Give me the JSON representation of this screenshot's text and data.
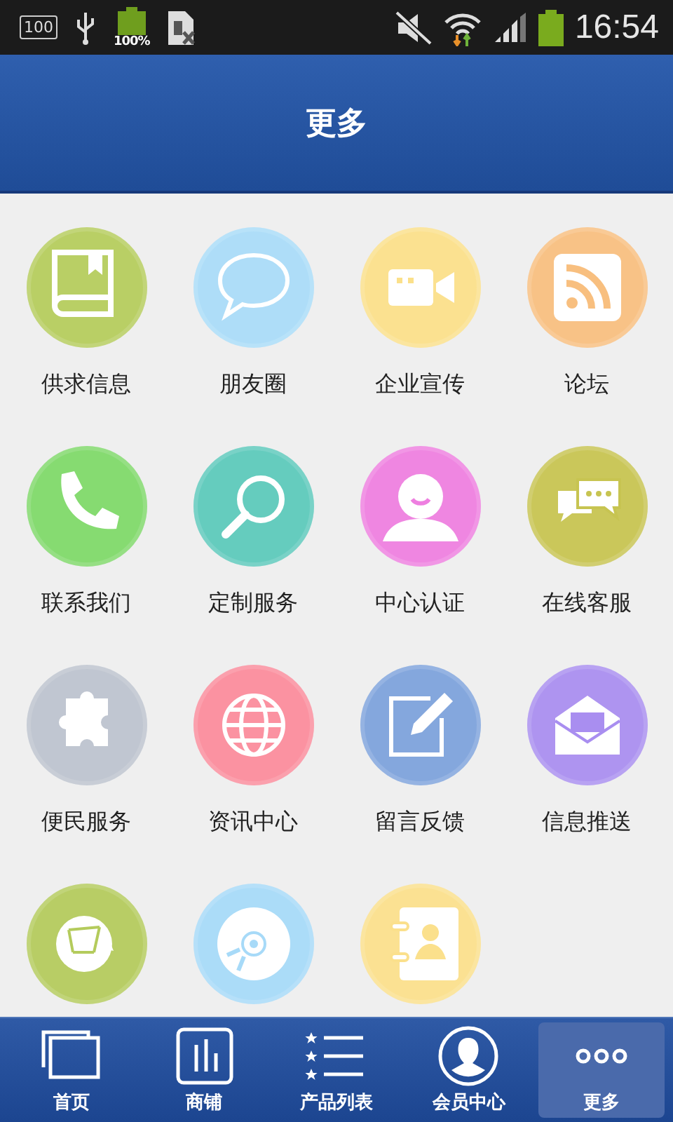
{
  "status_bar": {
    "notification_count": "100",
    "battery_percent": "100%",
    "time": "16:54"
  },
  "header": {
    "title": "更多"
  },
  "items": [
    {
      "label": "供求信息",
      "kind": "book",
      "color": "#b5cc5c"
    },
    {
      "label": "朋友圈",
      "kind": "chat",
      "color": "#a9dcf8"
    },
    {
      "label": "企业宣传",
      "kind": "camera",
      "color": "#fbe08a"
    },
    {
      "label": "论坛",
      "kind": "rss",
      "color": "#f8bf7f"
    },
    {
      "label": "联系我们",
      "kind": "phone",
      "color": "#7fd86a"
    },
    {
      "label": "定制服务",
      "kind": "search",
      "color": "#5cc9bb"
    },
    {
      "label": "中心认证",
      "kind": "user",
      "color": "#ee7fe0"
    },
    {
      "label": "在线客服",
      "kind": "bubbles",
      "color": "#c7c451"
    },
    {
      "label": "便民服务",
      "kind": "puzzle",
      "color": "#bcc3ce"
    },
    {
      "label": "资讯中心",
      "kind": "globe",
      "color": "#fb8b9b"
    },
    {
      "label": "留言反馈",
      "kind": "edit",
      "color": "#7ea3dc"
    },
    {
      "label": "信息推送",
      "kind": "mail",
      "color": "#a98ef0"
    },
    {
      "kind": "network",
      "color": "#b4cb5c"
    },
    {
      "kind": "disc",
      "color": "#a7daf8"
    },
    {
      "kind": "contacts",
      "color": "#fbe08c"
    }
  ],
  "tabs": [
    {
      "label": "首页",
      "kind": "home",
      "selected": false
    },
    {
      "label": "商铺",
      "kind": "shop",
      "selected": false
    },
    {
      "label": "产品列表",
      "kind": "list",
      "selected": false
    },
    {
      "label": "会员中心",
      "kind": "member",
      "selected": false
    },
    {
      "label": "更多",
      "kind": "more",
      "selected": true
    }
  ]
}
